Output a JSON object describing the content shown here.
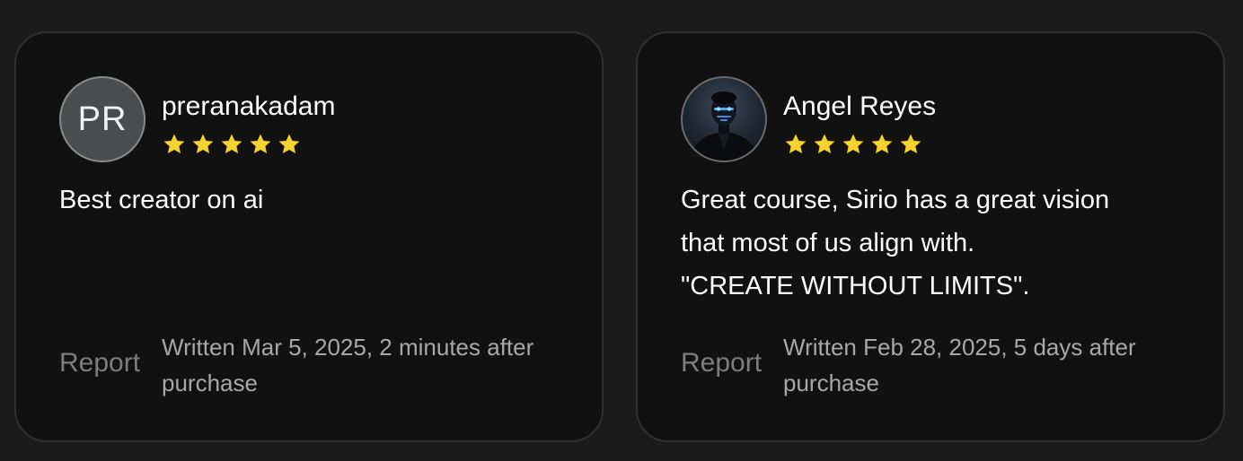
{
  "colors": {
    "background": "#1b1b1b",
    "card": "#111111",
    "card_border": "#303030",
    "star": "#f7d22b",
    "text": "#ffffff",
    "muted": "#a8a8a8",
    "report": "#7d7d7d"
  },
  "reviews": [
    {
      "avatar_type": "initials",
      "initials": "PR",
      "name": "preranakadam",
      "rating": 5,
      "text_lines": [
        "Best creator on ai"
      ],
      "report_label": "Report",
      "written": "Written Mar 5, 2025, 2 minutes after purchase"
    },
    {
      "avatar_type": "photo",
      "avatar_icon": "user-photo-icon",
      "name": "Angel Reyes",
      "rating": 5,
      "text_lines": [
        "Great course, Sirio has a great vision",
        "that most of us align with.",
        "\"CREATE WITHOUT LIMITS\"."
      ],
      "report_label": "Report",
      "written": "Written Feb 28, 2025, 5 days after purchase"
    }
  ]
}
